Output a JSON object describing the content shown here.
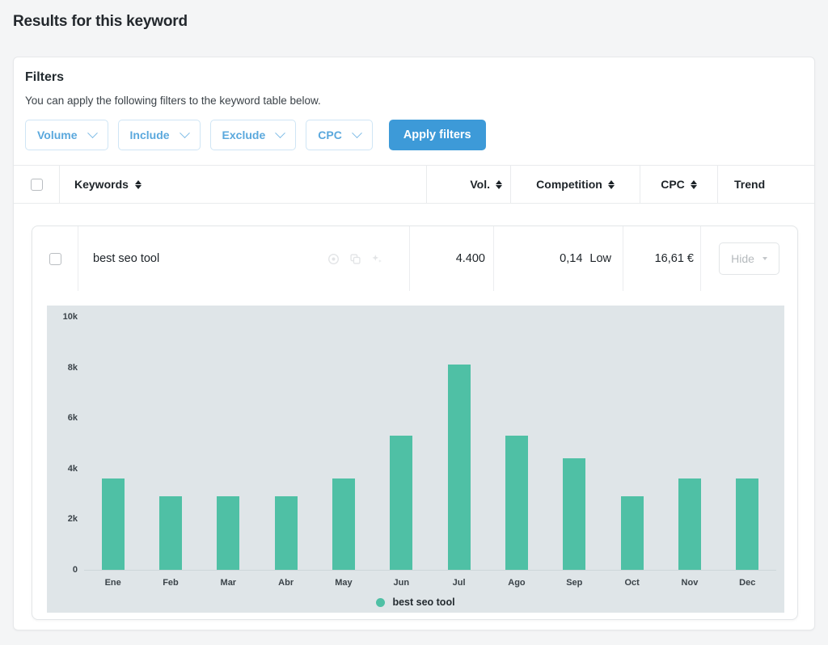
{
  "page": {
    "title": "Results for this keyword"
  },
  "filters": {
    "title": "Filters",
    "description": "You can apply the following filters to the keyword table below.",
    "buttons": [
      {
        "label": "Volume",
        "icon": "chevron-down-icon"
      },
      {
        "label": "Include",
        "icon": "chevron-down-icon"
      },
      {
        "label": "Exclude",
        "icon": "chevron-down-icon"
      },
      {
        "label": "CPC",
        "icon": "chevron-down-icon"
      }
    ],
    "apply_label": "Apply filters",
    "apply_color": "#3d9ad8"
  },
  "table": {
    "headers": {
      "keywords": "Keywords",
      "volume": "Vol.",
      "competition": "Competition",
      "cpc": "CPC",
      "trend": "Trend"
    },
    "row": {
      "keyword": "best seo tool",
      "volume": "4.400",
      "competition_value": "0,14",
      "competition_level": "Low",
      "cpc": "16,61 €",
      "hide_label": "Hide",
      "row_icons": [
        "target-icon",
        "copy-icon",
        "sparkle-icon"
      ]
    }
  },
  "chart_data": {
    "type": "bar",
    "title": "",
    "xlabel": "",
    "ylabel": "",
    "categories": [
      "Ene",
      "Feb",
      "Mar",
      "Abr",
      "May",
      "Jun",
      "Jul",
      "Ago",
      "Sep",
      "Oct",
      "Nov",
      "Dec"
    ],
    "values": [
      3600,
      2900,
      2900,
      2900,
      3600,
      5300,
      8100,
      5300,
      4400,
      2900,
      3600,
      3600
    ],
    "series": [
      {
        "name": "best seo tool",
        "color": "#4fc0a5",
        "values": [
          3600,
          2900,
          2900,
          2900,
          3600,
          5300,
          8100,
          5300,
          4400,
          2900,
          3600,
          3600
        ]
      }
    ],
    "ylim": [
      0,
      10000
    ],
    "yticks": [
      0,
      2000,
      4000,
      6000,
      8000,
      10000
    ],
    "ytick_labels": [
      "0",
      "2k",
      "4k",
      "6k",
      "8k",
      "10k"
    ],
    "grid": false,
    "legend": {
      "position": "bottom",
      "entries": [
        {
          "label": "best seo tool",
          "color": "#4fc0a5"
        }
      ]
    },
    "plot_background": "#dfe5e8"
  }
}
